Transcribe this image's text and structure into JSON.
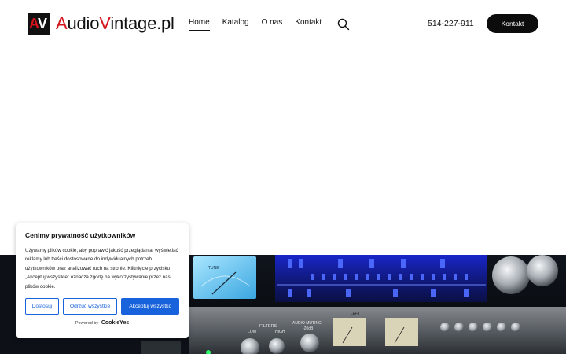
{
  "brand": {
    "logo_mark_a": "A",
    "logo_mark_v": "V",
    "name_part1": "A",
    "name_part2": "udio",
    "name_part3": "V",
    "name_part4": "intage.pl"
  },
  "nav": {
    "items": [
      {
        "label": "Home"
      },
      {
        "label": "Katalog"
      },
      {
        "label": "O nas"
      },
      {
        "label": "Kontakt"
      }
    ]
  },
  "header": {
    "phone": "514-227-911",
    "cta_label": "Kontakt"
  },
  "cookie_banner": {
    "title": "Cenimy prywatność użytkowników",
    "text": "Używamy plików cookie, aby poprawić jakość przeglądania, wyświetlać reklamy lub treści dostosowane do indywidualnych potrzeb użytkowników oraz analizować ruch na stronie. Kliknięcie przycisku „Akceptuj wszystkie” oznacza zgodę na wykorzystywanie przez nas plików cookie.",
    "buttons": {
      "customize": "Dostosuj",
      "reject": "Odrzuć wszystkie",
      "accept": "Akceptuj wszystko"
    },
    "powered_by": "Powered by",
    "powered_brand": "CookieYes"
  },
  "hero": {
    "panel_labels": {
      "tune": "TUNE",
      "filters": "FILTERS",
      "low": "LOW",
      "high": "HIGH",
      "audio_muting": "AUDIO MUTING",
      "muting_db": "-20dB",
      "left": "LEFT"
    }
  },
  "colors": {
    "accent_red": "#d3121b",
    "cookie_blue": "#1863dc",
    "cta_bg": "#0c0c0c"
  }
}
